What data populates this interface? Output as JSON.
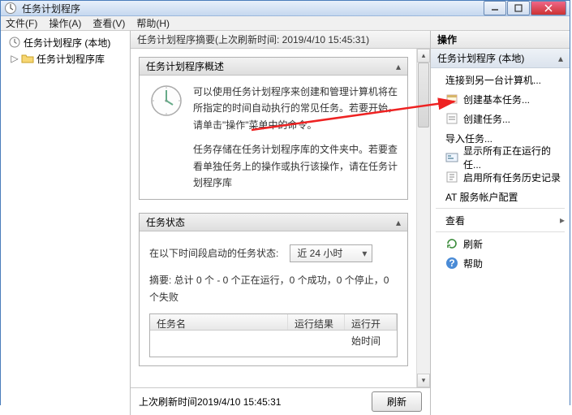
{
  "window": {
    "title": "任务计划程序"
  },
  "menubar": {
    "file": "文件(F)",
    "action": "操作(A)",
    "view": "查看(V)",
    "help": "帮助(H)"
  },
  "tree": {
    "root": "任务计划程序 (本地)",
    "lib": "任务计划程序库"
  },
  "summary": {
    "header": "任务计划程序摘要(上次刷新时间: 2019/4/10 15:45:31)",
    "overview_title": "任务计划程序概述",
    "overview_text1": "可以使用任务计划程序来创建和管理计算机将在所指定的时间自动执行的常见任务。若要开始，请单击\"操作\"菜单中的命令。",
    "overview_text2": "任务存储在任务计划程序库的文件夹中。若要查看单独任务上的操作或执行该操作，请在任务计划程序库",
    "status_title": "任务状态",
    "status_label": "在以下时间段启动的任务状态:",
    "status_range": "近 24 小时",
    "status_summary": "摘要: 总计 0 个 - 0 个正在运行，0 个成功，0 个停止，0 个失败",
    "col_name": "任务名",
    "col_result": "运行结果",
    "col_start": "运行开始时间",
    "footer_text": "上次刷新时间2019/4/10 15:45:31",
    "refresh_btn": "刷新"
  },
  "actions": {
    "header": "操作",
    "sub": "任务计划程序 (本地)",
    "items": {
      "connect": "连接到另一台计算机...",
      "create_basic": "创建基本任务...",
      "create": "创建任务...",
      "import": "导入任务...",
      "show_running": "显示所有正在运行的任...",
      "enable_history": "启用所有任务历史记录",
      "at_account": "AT 服务帐户配置",
      "view": "查看",
      "refresh": "刷新",
      "help": "帮助"
    }
  }
}
